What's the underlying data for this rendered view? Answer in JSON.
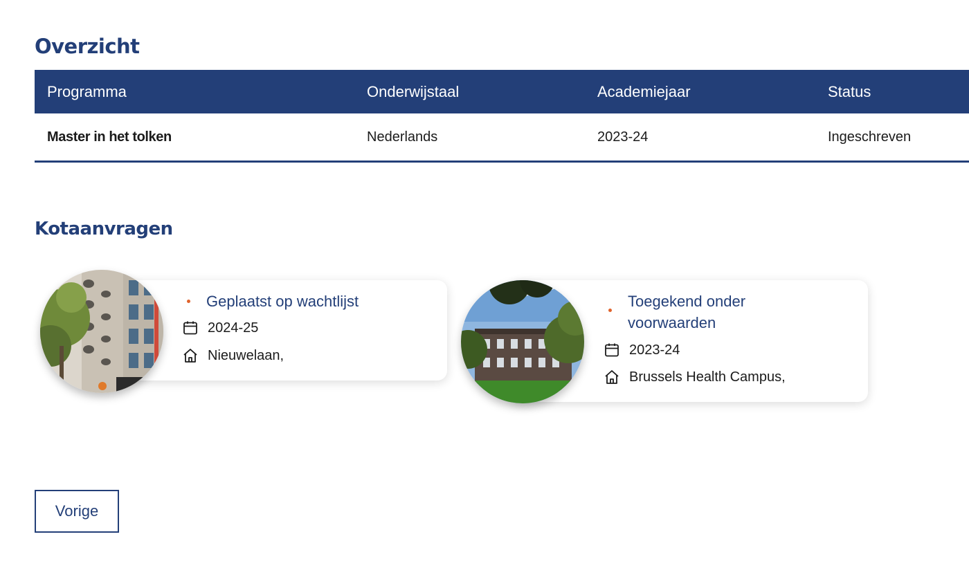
{
  "overview": {
    "title": "Overzicht",
    "columns": [
      "Programma",
      "Onderwijstaal",
      "Academiejaar",
      "Status"
    ],
    "rows": [
      {
        "program": "Master in het tolken",
        "language": "Nederlands",
        "year": "2023-24",
        "status": "Ingeschreven"
      }
    ]
  },
  "housing": {
    "title": "Kotaanvragen",
    "requests": [
      {
        "status": "Geplaatst op wachtlijst",
        "year": "2024-25",
        "address": "Nieuwelaan,",
        "image": "apartment-building-photo"
      },
      {
        "status": "Toegekend onder voorwaarden",
        "year": "2023-24",
        "address": "Brussels Health Campus,",
        "image": "campus-residence-photo"
      }
    ]
  },
  "actions": {
    "previous_label": "Vorige"
  },
  "colors": {
    "primary": "#233f78",
    "accent": "#e0632c"
  }
}
